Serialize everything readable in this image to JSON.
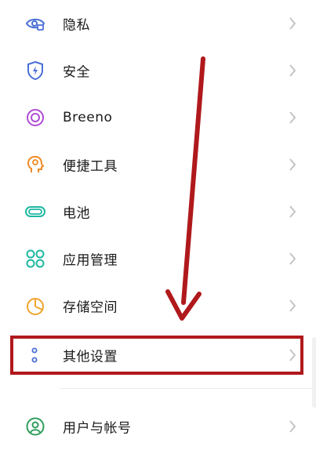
{
  "settings": {
    "items": [
      {
        "key": "privacy",
        "label": "隐私",
        "icon": "privacy-eye-icon"
      },
      {
        "key": "security",
        "label": "安全",
        "icon": "shield-bolt-icon"
      },
      {
        "key": "breeno",
        "label": "Breeno",
        "icon": "breeno-ring-icon"
      },
      {
        "key": "shortcuts",
        "label": "便捷工具",
        "icon": "head-gear-icon"
      },
      {
        "key": "battery",
        "label": "电池",
        "icon": "battery-icon"
      },
      {
        "key": "apps",
        "label": "应用管理",
        "icon": "app-grid-icon"
      },
      {
        "key": "storage",
        "label": "存储空间",
        "icon": "pie-chart-icon"
      },
      {
        "key": "other",
        "label": "其他设置",
        "icon": "dots-icon"
      },
      {
        "key": "account",
        "label": "用户与帐号",
        "icon": "user-circle-icon"
      }
    ]
  },
  "annotation": {
    "highlight_color": "#b0191c",
    "highlighted_item": "其他设置"
  },
  "colors": {
    "privacy": "#4a6fd6",
    "security": "#4a6fd6",
    "breeno": "#b04bd6",
    "shortcuts": "#f08a24",
    "battery": "#1fb8a2",
    "apps": "#1fb8a2",
    "storage": "#f0a52a",
    "other": "#4a6fd6",
    "account": "#2f9e5c",
    "chevron": "#c4c4c4"
  }
}
